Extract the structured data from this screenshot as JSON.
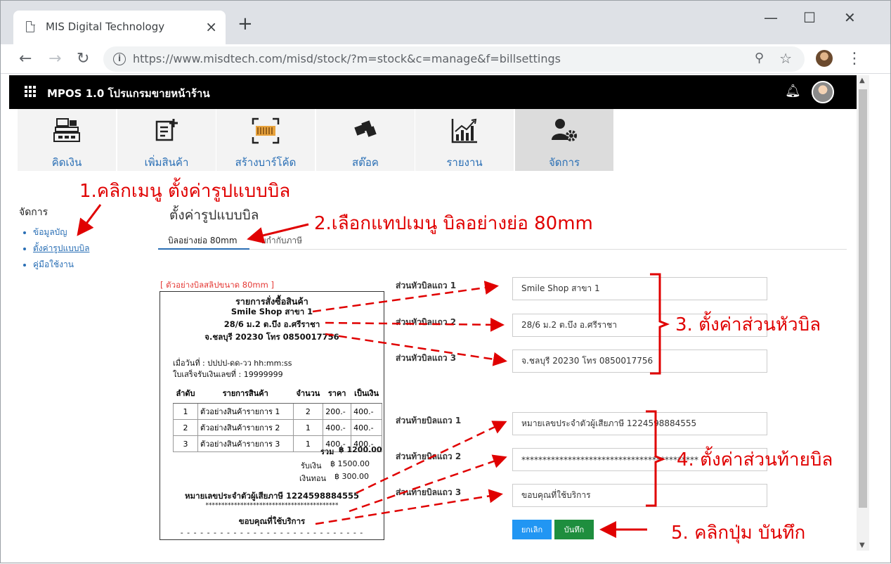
{
  "browser": {
    "tab_title": "MIS Digital Technology",
    "tab_close": "×",
    "new_tab": "+",
    "url": "https://www.misdtech.com/misd/stock/?m=stock&c=manage&f=billsettings",
    "window_controls": {
      "minimize": "—",
      "maximize": "☐",
      "close": "✕"
    },
    "nav": {
      "back": "←",
      "forward": "→",
      "reload": "↻"
    }
  },
  "app": {
    "title": "MPOS 1.0 โปรแกรมขายหน้าร้าน"
  },
  "menu_tiles": [
    {
      "label": "คิดเงิน",
      "icon": "cash-register-icon"
    },
    {
      "label": "เพิ่มสินค้า",
      "icon": "add-product-icon"
    },
    {
      "label": "สร้างบาร์โค้ด",
      "icon": "barcode-icon"
    },
    {
      "label": "สต๊อค",
      "icon": "stock-boxes-icon"
    },
    {
      "label": "รายงาน",
      "icon": "report-chart-icon"
    },
    {
      "label": "จัดการ",
      "icon": "user-gear-icon"
    }
  ],
  "sidebar": {
    "title": "จัดการ",
    "items": [
      {
        "label": "ข้อมูลบัญ"
      },
      {
        "label": "ตั้งค่ารูปแบบบิล"
      },
      {
        "label": "คู่มือใช้งาน"
      }
    ]
  },
  "main": {
    "page_title": "ตั้งค่ารูปแบบบิล",
    "tabs": [
      {
        "label": "บิลอย่างย่อ 80mm"
      },
      {
        "label": "บกำกับภาษี"
      }
    ]
  },
  "receipt": {
    "caption": "[ ตัวอย่างบิลสลิปขนาด 80mm ]",
    "heading": "รายการสั่งซื้อสินค้า",
    "header_lines": [
      "Smile Shop สาขา 1",
      "28/6 ม.2 ต.บึง อ.ศรีราชา",
      "จ.ชลบุรี 20230 โทร 0850017756"
    ],
    "date_line": "เมื่อวันที่ : ปปปป-ดด-วว hh:mm:ss",
    "receipt_no": "ใบเสร็จรับเงินเลขที่ : 19999999",
    "columns": [
      "ลำดับ",
      "รายการสินค้า",
      "จำนวน",
      "ราคา",
      "เป็นเงิน"
    ],
    "rows": [
      [
        "1",
        "ตัวอย่างสินค้ารายการ 1",
        "2",
        "200.-",
        "400.-"
      ],
      [
        "2",
        "ตัวอย่างสินค้ารายการ 2",
        "1",
        "400.-",
        "400.-"
      ],
      [
        "3",
        "ตัวอย่างสินค้ารายการ 3",
        "1",
        "400.-",
        "400.-"
      ]
    ],
    "total_label": "รวม",
    "total_value": "฿ 1200.00",
    "received_label": "รับเงิน",
    "received_value": "฿ 1500.00",
    "change_label": "เงินทอน",
    "change_value": "฿ 300.00",
    "footer_lines": [
      "หมายเลขประจำตัวผู้เสียภาษี 1224598884555",
      "******************************************",
      "ขอบคุณที่ใช้บริการ"
    ],
    "cut_line": "- - - - - - - - - - - - - - - - - - - - - - - - - - - -"
  },
  "form": {
    "header_labels": [
      "ส่วนหัวบิลแถว 1",
      "ส่วนหัวบิลแถว 2",
      "ส่วนหัวบิลแถว 3"
    ],
    "header_values": [
      "Smile Shop สาขา 1",
      "28/6 ม.2 ต.บึง อ.ศรีราชา",
      "จ.ชลบุรี 20230 โทร 0850017756"
    ],
    "footer_labels": [
      "ส่วนท้ายบิลแถว 1",
      "ส่วนท้ายบิลแถว 2",
      "ส่วนท้ายบิลแถว 3"
    ],
    "footer_values": [
      "หมายเลขประจำตัวผู้เสียภาษี 1224598884555",
      "******************************************",
      "ขอบคุณที่ใช้บริการ"
    ],
    "cancel_label": "ยกเลิก",
    "save_label": "บันทึก"
  },
  "annotations": {
    "step1": "1.คลิกเมนู ตั้งค่ารูปแบบบิล",
    "step2": "2.เลือกแทปเมนู บิลอย่างย่อ 80mm",
    "step3": "3. ตั้งค่าส่วนหัวบิล",
    "step4": "4. ตั้งค่าส่วนท้ายบิล",
    "step5": "5. คลิกปุ่ม บันทึก",
    "color": "#e00000"
  }
}
